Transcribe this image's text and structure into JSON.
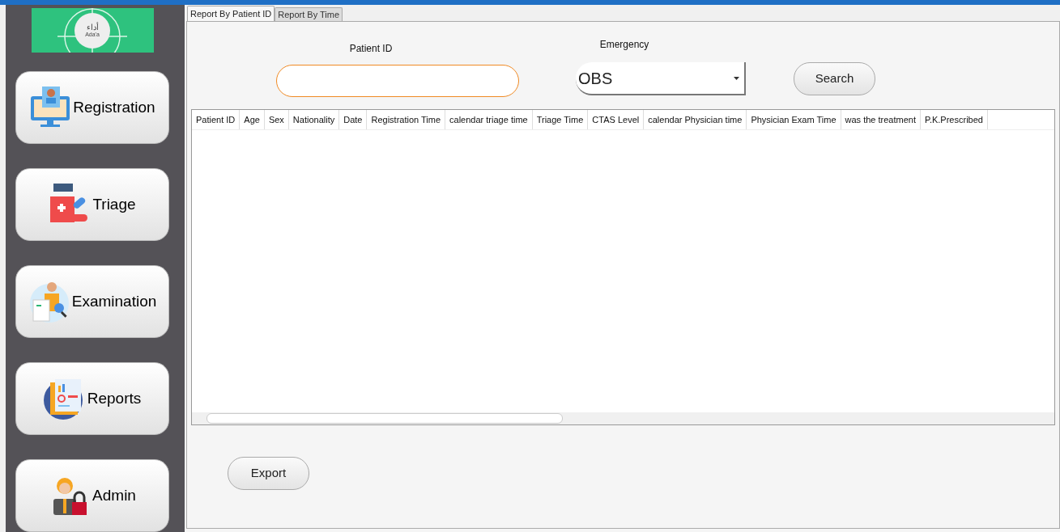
{
  "logo": {
    "arabic": "أداء",
    "latin": "Ada'a"
  },
  "nav": [
    {
      "label": "Registration",
      "kind": "registration"
    },
    {
      "label": "Triage",
      "kind": "triage"
    },
    {
      "label": "Examination",
      "kind": "examination"
    },
    {
      "label": "Reports",
      "kind": "reports"
    },
    {
      "label": "Admin",
      "kind": "admin"
    }
  ],
  "tabs": [
    {
      "label": "Report By Patient ID",
      "selected": true
    },
    {
      "label": "Report By Time",
      "selected": false
    }
  ],
  "patient_id": {
    "label": "Patient ID"
  },
  "emergency": {
    "label": "Emergency",
    "value": "OBS"
  },
  "search_button": "Search",
  "table": {
    "columns": [
      "Patient ID",
      "Age",
      "Sex",
      "Nationality",
      "Date",
      "Registration Time",
      "calendar triage time",
      "Triage Time",
      "CTAS Level",
      "calendar Physician time",
      "Physician Exam Time",
      "was the treatment",
      "P.K.Prescribed"
    ]
  },
  "export_button": "Export"
}
